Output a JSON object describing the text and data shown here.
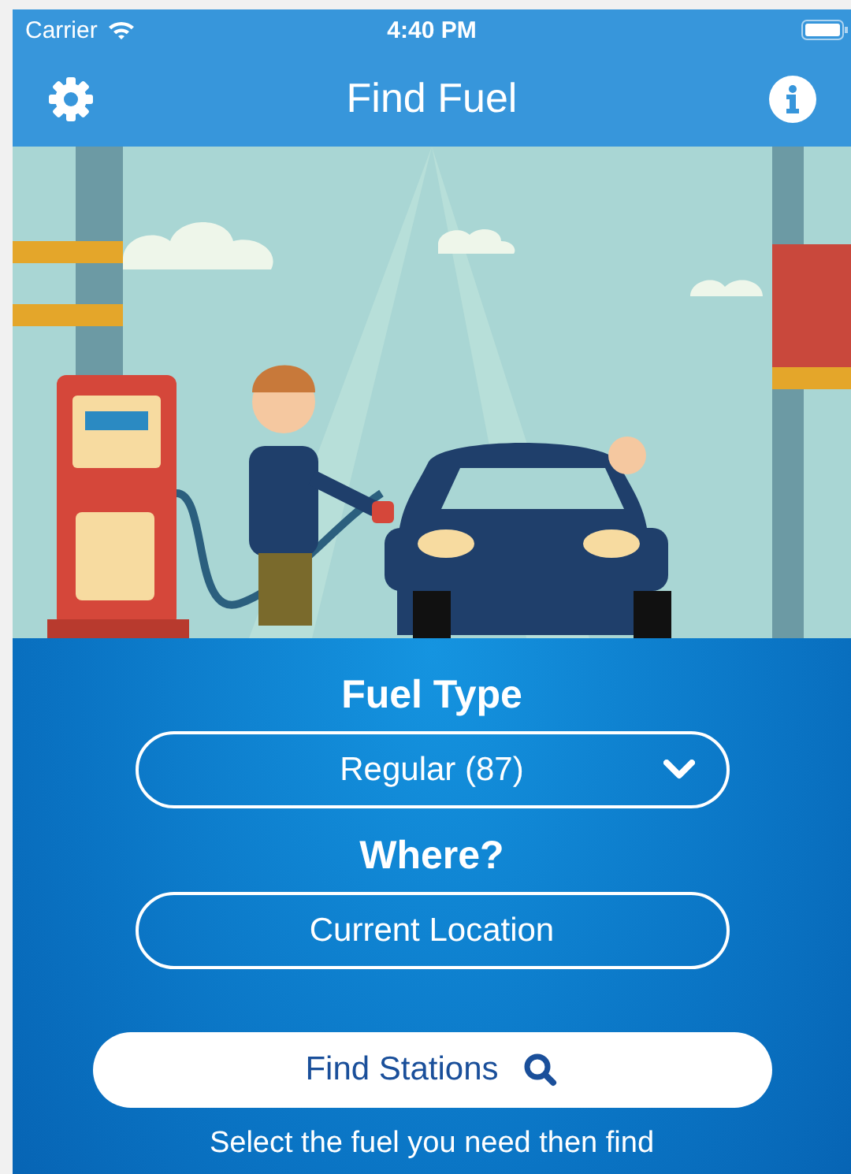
{
  "status_bar": {
    "carrier": "Carrier",
    "time": "4:40 PM"
  },
  "nav_bar": {
    "title": "Find Fuel"
  },
  "form": {
    "fuel_type_label": "Fuel Type",
    "fuel_type": "Regular (87)",
    "where_label": "Where?",
    "location": "Current Location",
    "find_button": "Find Stations"
  },
  "hint": "Select the fuel you need then find"
}
